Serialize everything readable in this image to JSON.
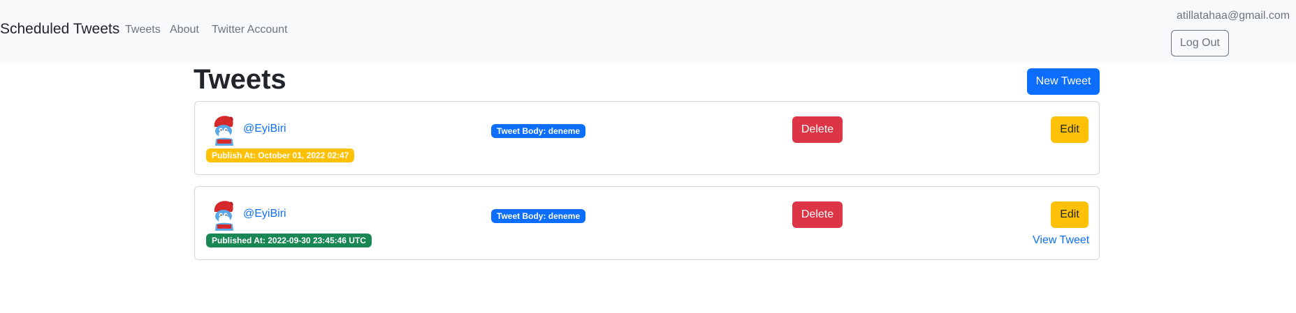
{
  "navbar": {
    "brand": "Scheduled Tweets",
    "links": [
      "Tweets",
      "About",
      "Twitter Account"
    ],
    "user_email": "atillatahaa@gmail.com",
    "logout_label": "Log Out"
  },
  "page": {
    "title": "Tweets",
    "new_tweet_label": "New Tweet"
  },
  "tweets": [
    {
      "handle": "@EyiBiri",
      "body": "Tweet Body: deneme",
      "status": "Publish At: October 01, 2022 02:47",
      "delete_label": "Delete",
      "edit_label": "Edit"
    },
    {
      "handle": "@EyiBiri",
      "body": "Tweet Body: deneme",
      "status": "Published At: 2022-09-30 23:45:46 UTC",
      "delete_label": "Delete",
      "edit_label": "Edit",
      "view_label": "View Tweet"
    }
  ],
  "colors": {
    "primary": "#0d6efd",
    "danger": "#dc3545",
    "warning": "#ffc107",
    "success": "#198754",
    "navbar_bg": "#f8f9fa"
  },
  "icons": {
    "avatar": "smurf-avatar-icon"
  }
}
